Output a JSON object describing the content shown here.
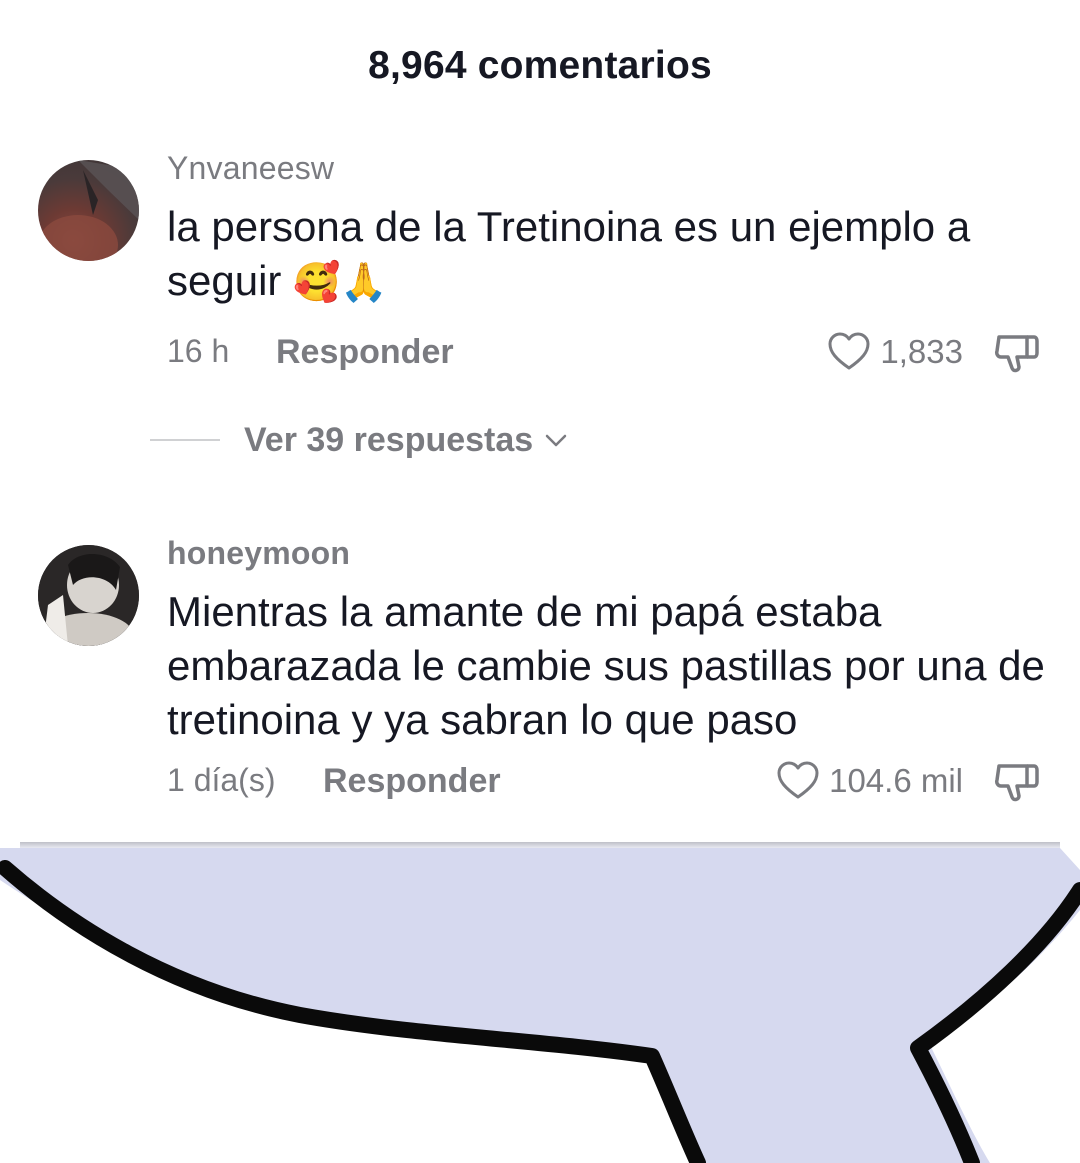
{
  "header": {
    "title": "8,964 comentarios"
  },
  "comments": [
    {
      "username": "Ynvaneesw",
      "text": "la persona de la Tretinoina es un ejemplo a seguir",
      "emojis": "🥰🙏",
      "time": "16 h",
      "reply_label": "Responder",
      "likes": "1,833",
      "view_replies": "Ver 39 respuestas"
    },
    {
      "username": "honeymoon",
      "text": "Mientras la amante de mi papá estaba embarazada le cambie sus pastillas por una de tretinoina y ya sabran lo que paso",
      "time": "1 día(s)",
      "reply_label": "Responder",
      "likes": "104.6 mil"
    }
  ],
  "icons": {
    "like": "heart-outline-icon",
    "dislike": "thumbs-down-icon",
    "expand": "chevron-down-icon"
  },
  "colors": {
    "text_primary": "#161823",
    "text_secondary": "#7a7b80",
    "bubble_fill": "#d6d9ef",
    "bubble_outline": "#000000"
  }
}
